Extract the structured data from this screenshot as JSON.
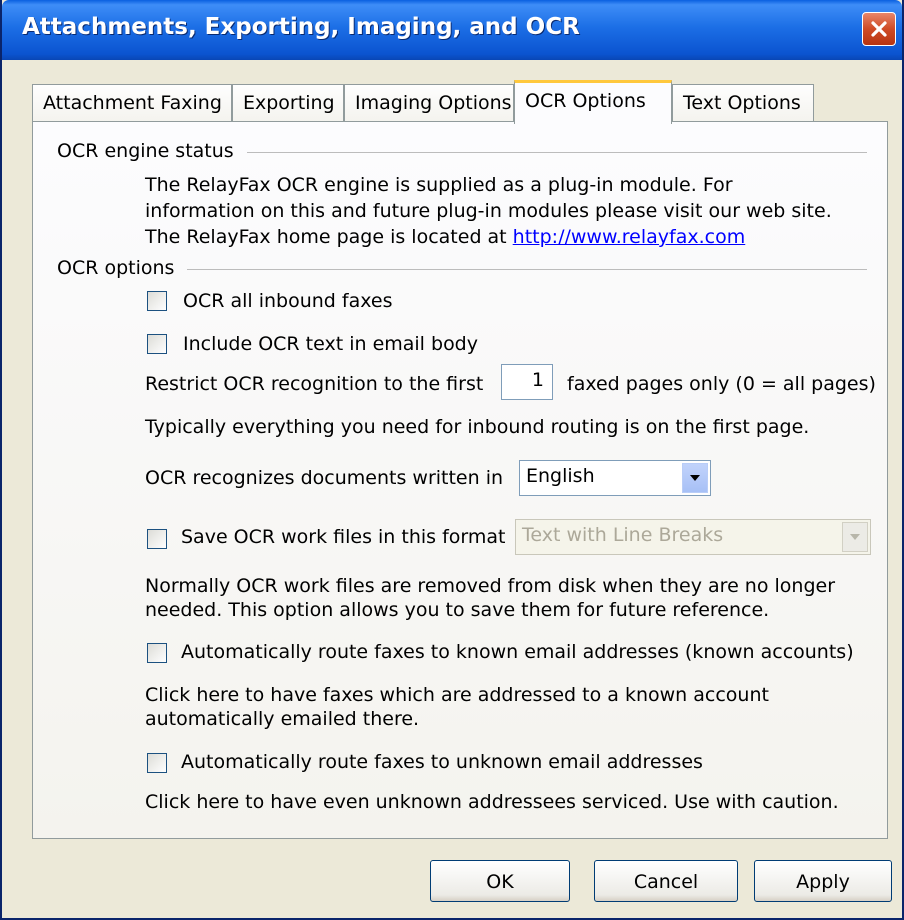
{
  "window": {
    "title": "Attachments, Exporting, Imaging, and OCR"
  },
  "tabs": [
    {
      "label": "Attachment Faxing"
    },
    {
      "label": "Exporting"
    },
    {
      "label": "Imaging Options"
    },
    {
      "label": "OCR Options",
      "active": true
    },
    {
      "label": "Text Options"
    }
  ],
  "engine_status": {
    "label": "OCR engine status",
    "line1": "The RelayFax OCR engine is supplied as a plug-in module.  For",
    "line2": "information on this and future plug-in modules please visit our web site.",
    "line3_prefix": "The RelayFax home page is located at ",
    "link": "http://www.relayfax.com"
  },
  "ocr_options": {
    "label": "OCR options",
    "ocr_all": {
      "label": "OCR all inbound faxes",
      "checked": false
    },
    "include_text": {
      "label": "Include OCR text in email body",
      "checked": false
    },
    "restrict_prefix": "Restrict OCR recognition to the first",
    "restrict_value": "1",
    "restrict_suffix": "faxed pages only (0 = all pages)",
    "restrict_note": "Typically everything you need for inbound routing is on the first page.",
    "language_label": "OCR recognizes documents written in",
    "language_value": "English",
    "save_work": {
      "label": "Save OCR work files in this format",
      "checked": false
    },
    "format_value": "Text with Line Breaks",
    "save_note_1": "Normally OCR work files are removed from disk when they are no longer",
    "save_note_2": "needed.  This option allows you to save them for future reference.",
    "route_known": {
      "label": "Automatically route faxes to known email addresses (known accounts)",
      "checked": false
    },
    "known_note_1": "Click here to have faxes which are addressed to a known account",
    "known_note_2": "automatically emailed there.",
    "route_unknown": {
      "label": "Automatically route faxes to unknown email addresses",
      "checked": false
    },
    "unknown_note": "Click here to have even unknown addressees serviced.  Use with caution."
  },
  "buttons": {
    "ok": "OK",
    "cancel": "Cancel",
    "apply": "Apply"
  },
  "colors": {
    "titlebar": "#0b54d0",
    "face": "#ece9d8",
    "link": "#0000ff",
    "active_tab_accent": "#ffc83c",
    "close": "#cf4b26"
  }
}
